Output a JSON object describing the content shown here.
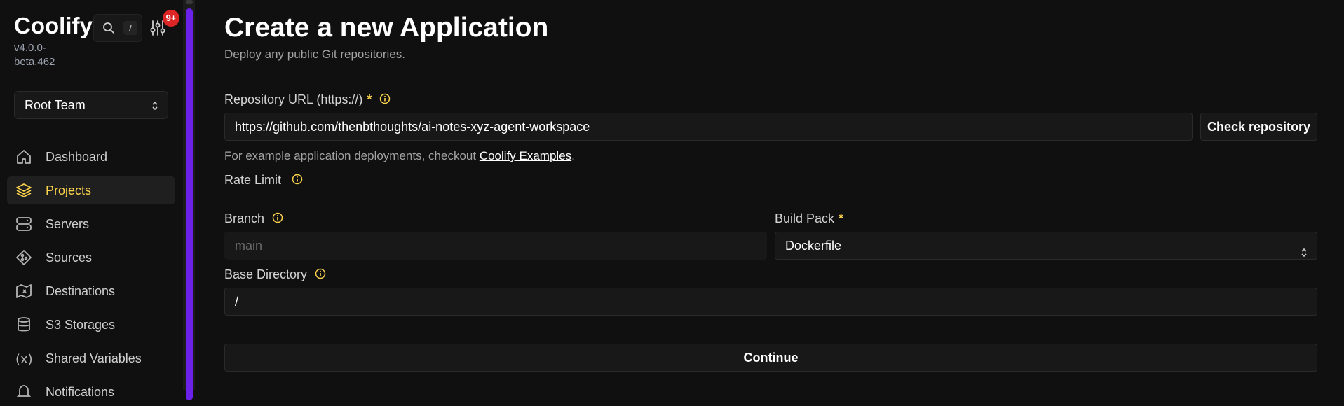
{
  "app": {
    "name": "Coolify",
    "version": "v4.0.0-beta.462"
  },
  "search": {
    "shortcut": "/"
  },
  "notifications": {
    "badge": "9+"
  },
  "team": {
    "selected": "Root Team"
  },
  "nav": [
    {
      "label": "Dashboard",
      "icon": "home-icon",
      "active": false
    },
    {
      "label": "Projects",
      "icon": "layers-icon",
      "active": true
    },
    {
      "label": "Servers",
      "icon": "server-icon",
      "active": false
    },
    {
      "label": "Sources",
      "icon": "git-icon",
      "active": false
    },
    {
      "label": "Destinations",
      "icon": "map-icon",
      "active": false
    },
    {
      "label": "S3 Storages",
      "icon": "database-icon",
      "active": false
    },
    {
      "label": "Shared Variables",
      "icon": "variable-icon",
      "active": false
    },
    {
      "label": "Notifications",
      "icon": "bell-icon",
      "active": false
    }
  ],
  "colors": {
    "accent": "#fcd34d",
    "scrollbar": "#6b21e8",
    "badge": "#dc2626"
  },
  "page": {
    "title": "Create a new Application",
    "subtitle": "Deploy any public Git repositories."
  },
  "form": {
    "repo_label": "Repository URL (https://)",
    "repo_value": "https://github.com/thenbthoughts/ai-notes-xyz-agent-workspace",
    "check_button": "Check repository",
    "help_prefix": "For example application deployments, checkout",
    "help_link": "Coolify Examples",
    "help_suffix": ".",
    "rate_limit_label": "Rate Limit",
    "branch_label": "Branch",
    "branch_value": "main",
    "buildpack_label": "Build Pack",
    "buildpack_value": "Dockerfile",
    "basedir_label": "Base Directory",
    "basedir_value": "/",
    "continue_button": "Continue"
  }
}
